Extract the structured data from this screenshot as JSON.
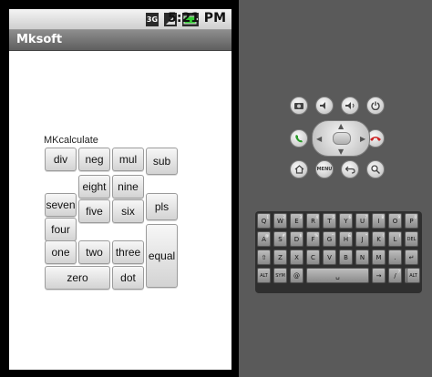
{
  "status_bar": {
    "network_label": "3G",
    "time": "5:21 PM"
  },
  "app": {
    "title": "Mksoft",
    "heading": "MKcalculate"
  },
  "calc": {
    "div": "div",
    "neg": "neg",
    "mul": "mul",
    "sub": "sub",
    "seven": "seven",
    "eight": "eight",
    "nine": "nine",
    "pls": "pls",
    "four": "four",
    "five": "five",
    "six": "six",
    "one": "one",
    "two": "two",
    "three": "three",
    "equal": "equal",
    "zero": "zero",
    "dot": "dot"
  },
  "keyboard": {
    "row1": [
      {
        "k": "Q",
        "s": "1"
      },
      {
        "k": "W",
        "s": "2"
      },
      {
        "k": "E",
        "s": "3"
      },
      {
        "k": "R",
        "s": "4"
      },
      {
        "k": "T",
        "s": "5"
      },
      {
        "k": "Y",
        "s": "6"
      },
      {
        "k": "U",
        "s": "7"
      },
      {
        "k": "I",
        "s": "8"
      },
      {
        "k": "O",
        "s": "9"
      },
      {
        "k": "P",
        "s": "0"
      }
    ],
    "row2": [
      {
        "k": "A",
        "s": "@"
      },
      {
        "k": "S",
        "s": "#"
      },
      {
        "k": "D",
        "s": "$"
      },
      {
        "k": "F",
        "s": "%"
      },
      {
        "k": "G",
        "s": "^"
      },
      {
        "k": "H",
        "s": "&"
      },
      {
        "k": "J",
        "s": "*"
      },
      {
        "k": "K",
        "s": "("
      },
      {
        "k": "L",
        "s": ")"
      },
      {
        "k": "DEL",
        "s": ""
      }
    ],
    "row3": [
      {
        "k": "⇧",
        "s": ""
      },
      {
        "k": "Z",
        "s": ""
      },
      {
        "k": "X",
        "s": ""
      },
      {
        "k": "C",
        "s": ""
      },
      {
        "k": "V",
        "s": ""
      },
      {
        "k": "B",
        "s": ""
      },
      {
        "k": "N",
        "s": ""
      },
      {
        "k": "M",
        "s": ""
      },
      {
        "k": ".",
        "s": ""
      },
      {
        "k": "↵",
        "s": ""
      }
    ],
    "row4": [
      {
        "k": "ALT",
        "s": ""
      },
      {
        "k": "SYM",
        "s": ""
      },
      {
        "k": "@",
        "s": ""
      },
      {
        "k": "␣",
        "s": ""
      },
      {
        "k": "→",
        "s": ""
      },
      {
        "k": "/",
        "s": "?"
      },
      {
        "k": ",",
        "s": ""
      },
      {
        "k": "ALT",
        "s": ""
      }
    ]
  },
  "controls": {
    "menu_label": "MENU"
  }
}
